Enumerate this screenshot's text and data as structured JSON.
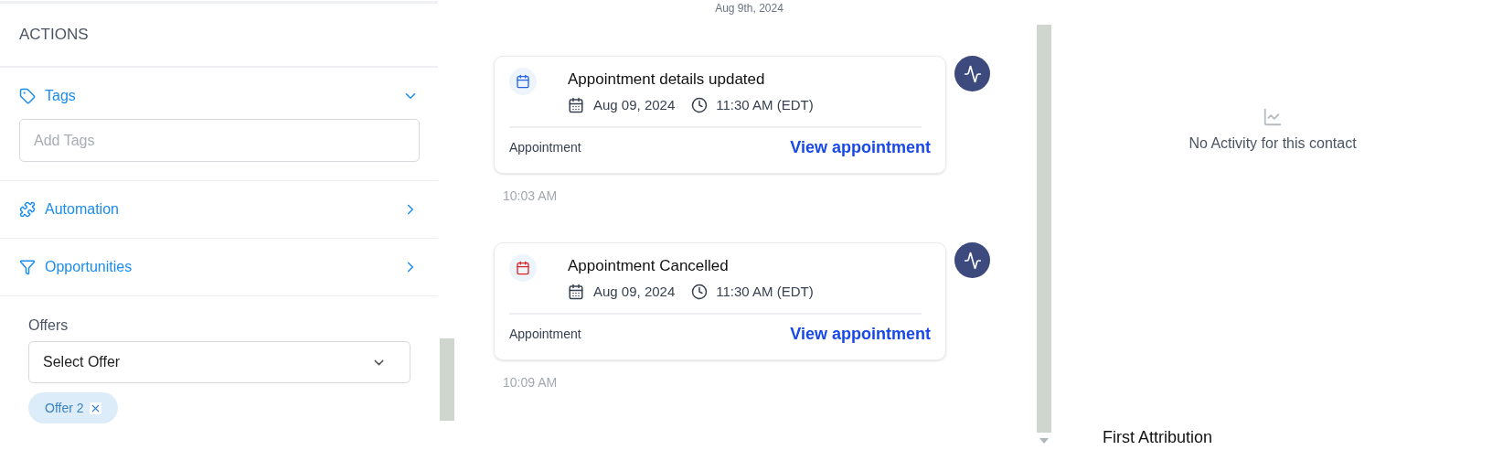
{
  "actions_panel": {
    "title": "ACTIONS",
    "sections": [
      {
        "kind": "tags",
        "label": "Tags",
        "expanded": true,
        "placeholder": "Add Tags"
      },
      {
        "kind": "automation",
        "label": "Automation",
        "expanded": false
      },
      {
        "kind": "opportunities",
        "label": "Opportunities",
        "expanded": false
      }
    ],
    "offers": {
      "label": "Offers",
      "select": "Select Offer",
      "chips": [
        "Offer 2"
      ]
    }
  },
  "timeline": {
    "date": "Aug 9th, 2024",
    "events": [
      {
        "title": "Appointment details updated",
        "color": "#2563eb",
        "date": "Aug 09, 2024",
        "time": "11:30 AM (EDT)",
        "category": "Appointment",
        "link": "View appointment",
        "logged": "10:03 AM"
      },
      {
        "title": "Appointment Cancelled",
        "color": "#dc2626",
        "date": "Aug 09, 2024",
        "time": "11:30 AM (EDT)",
        "category": "Appointment",
        "link": "View appointment",
        "logged": "10:09 AM"
      }
    ]
  },
  "activity_panel": {
    "empty_message": "No Activity for this contact",
    "next_heading": "First Attribution"
  }
}
